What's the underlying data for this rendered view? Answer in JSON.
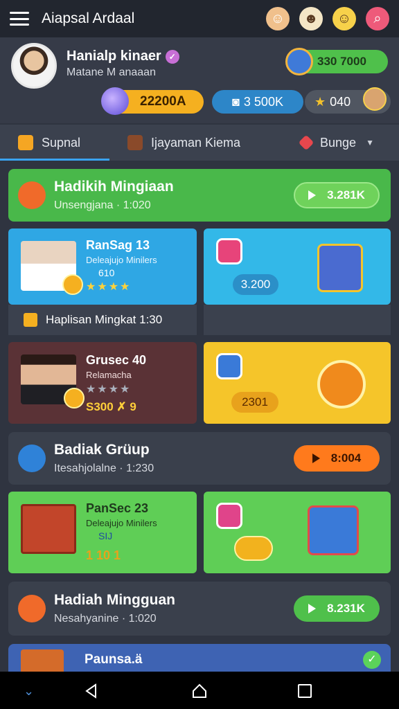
{
  "app": {
    "title": "Aiapsal Ardaal"
  },
  "header_icons": [
    "avatar-boy-icon",
    "chef-icon",
    "blonde-avatar-icon",
    "search-icon"
  ],
  "profile": {
    "name": "Hanialp kinaer",
    "subtitle": "Matane M anaaan",
    "coin_pill": "330 7000",
    "stat_yellow": "22200A",
    "stat_blue": "3 500K",
    "stat_dark": "040"
  },
  "tabs": [
    {
      "label": "Supnal",
      "active": true
    },
    {
      "label": "Ijayaman Kiema",
      "active": false
    },
    {
      "label": "Bunge",
      "active": false
    }
  ],
  "banners": {
    "b1": {
      "title": "Hadikih Mingiaan",
      "subtitle": "Unsengjana · 1:020",
      "button": "3.281K",
      "color": "#49b84a"
    },
    "b2": {
      "title": "Badiak Grüup",
      "subtitle": "Itesahjolalne · 1:230",
      "button": "8:004",
      "color": "#3a404c"
    },
    "b3": {
      "title": "Hadiah Mingguan",
      "subtitle": "Nesahyanine · 1:020",
      "button": "8.231K",
      "color": "#3a404c"
    }
  },
  "tiles": {
    "t1": {
      "name": "RanSag 13",
      "sub": "Deleajujo Minilers",
      "extra": "610",
      "rating": "★★★★",
      "footer": "Haplisan Mingkat 1:30"
    },
    "t1_right": {
      "amount": "3.200"
    },
    "t2": {
      "name": "Grusec 40",
      "sub": "Relamacha",
      "rating_line": "★★★★",
      "amount": "S300 ✗ 9"
    },
    "t2_right": {
      "amount": "2301"
    },
    "t3": {
      "name": "PanSec 23",
      "sub": "Deleajujo Minilers",
      "extra": "SIJ",
      "amount": "1 10 1"
    },
    "t3_right": {
      "amount": ""
    }
  },
  "partial": {
    "title": "Paunsa.ä"
  },
  "colors": {
    "green": "#4fc04b",
    "blue": "#2fa7e4",
    "yellow": "#f5c52a",
    "maroon": "#5a3236",
    "orange": "#ff7a1c",
    "page_bg": "#2f3440"
  }
}
